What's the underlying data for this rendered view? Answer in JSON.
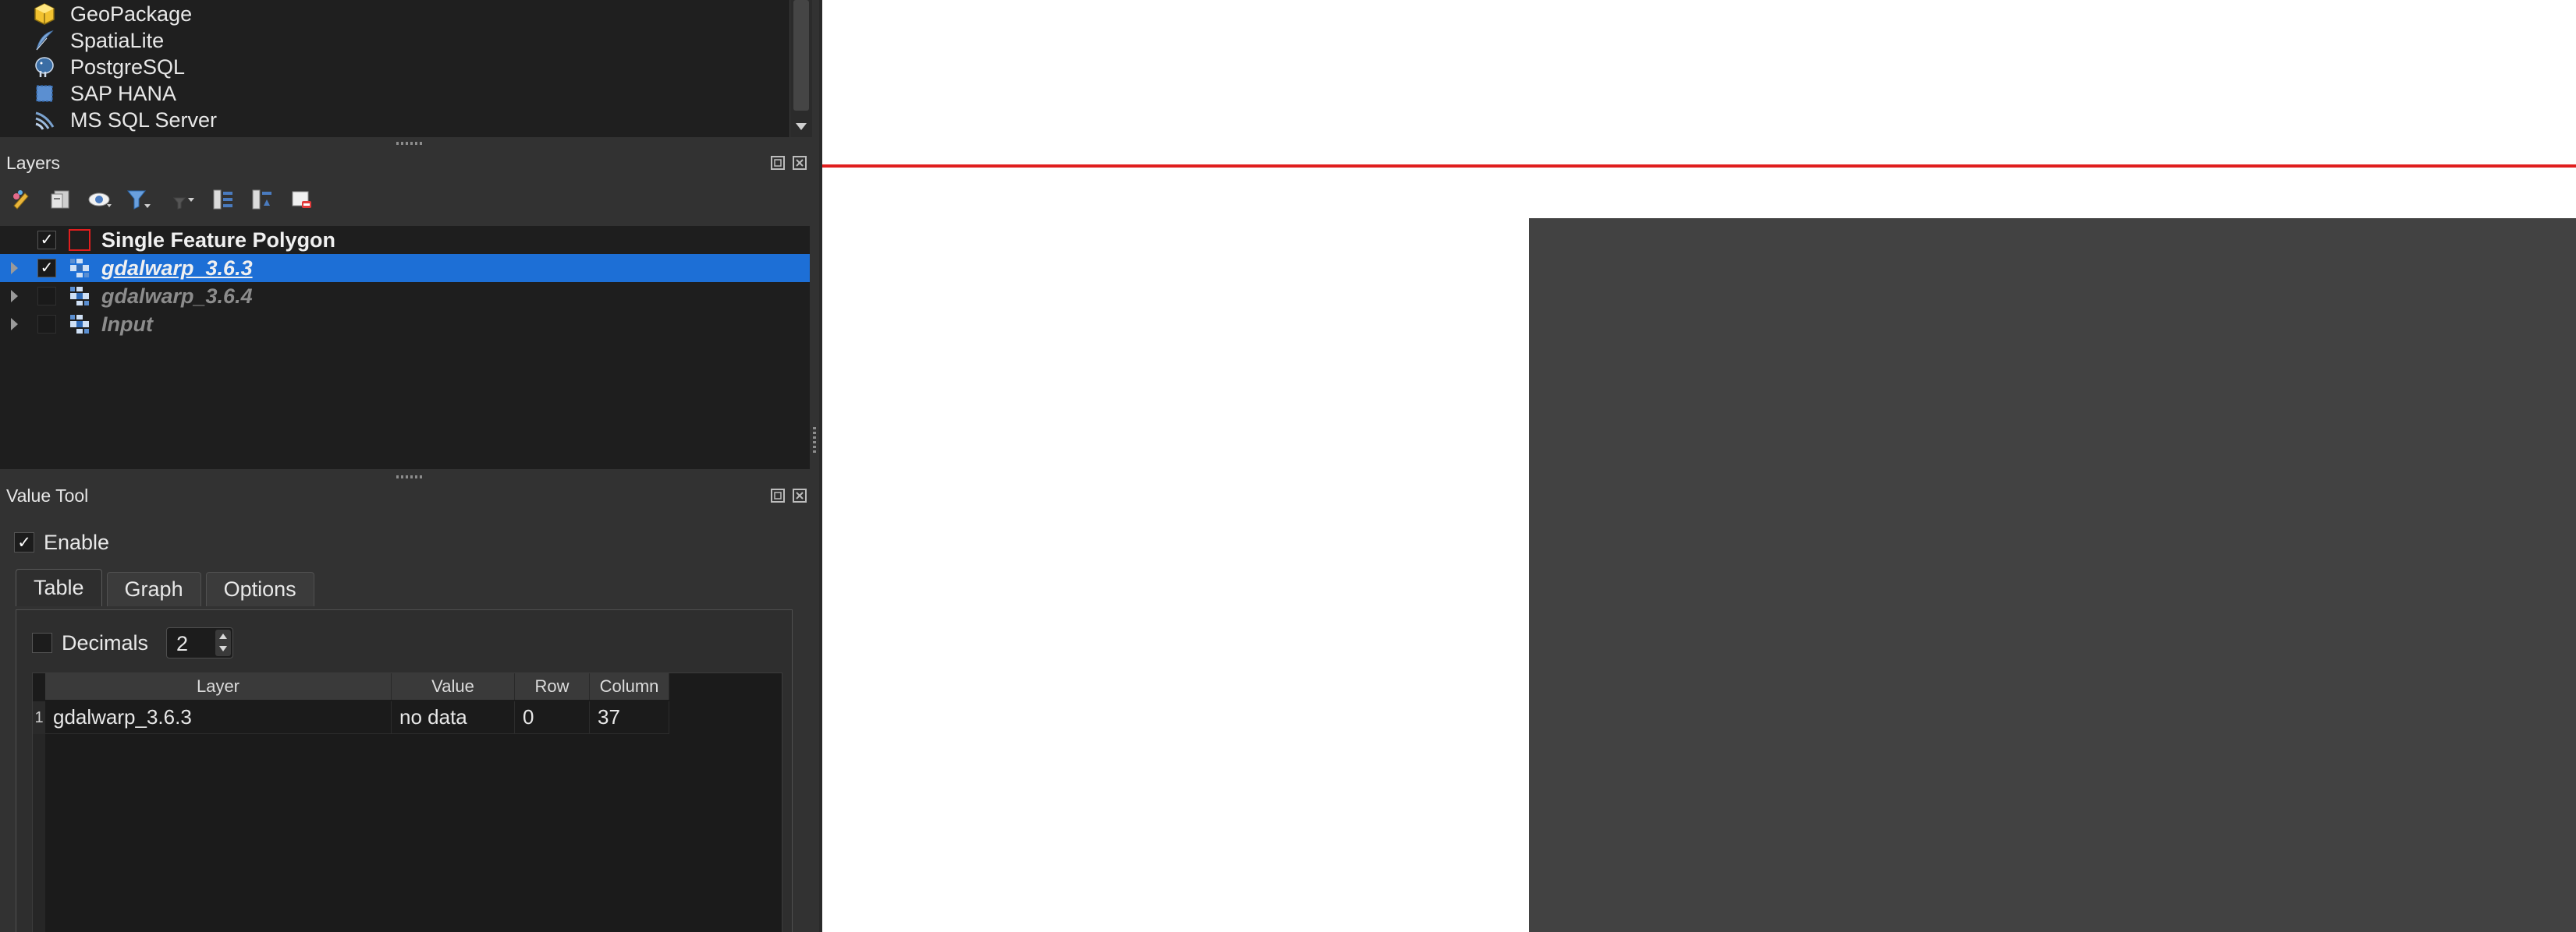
{
  "browser": {
    "items": [
      {
        "label": "GeoPackage",
        "icon": "geopackage-icon"
      },
      {
        "label": "SpatiaLite",
        "icon": "spatialite-feather-icon"
      },
      {
        "label": "PostgreSQL",
        "icon": "postgresql-elephant-icon"
      },
      {
        "label": "SAP HANA",
        "icon": "sap-hana-icon"
      },
      {
        "label": "MS SQL Server",
        "icon": "mssql-server-icon"
      }
    ]
  },
  "layers_panel": {
    "title": "Layers",
    "toolbar": [
      "open-layer-styling-icon",
      "add-group-icon",
      "manage-map-themes-icon",
      "filter-legend-icon",
      "filter-by-expression-icon",
      "expand-all-icon",
      "collapse-all-icon",
      "remove-layer-icon"
    ],
    "layers": [
      {
        "name": "Single Feature Polygon",
        "checked": true,
        "type": "vector-polygon"
      },
      {
        "name": "gdalwarp_3.6.3",
        "checked": true,
        "type": "raster",
        "selected": true
      },
      {
        "name": "gdalwarp_3.6.4",
        "checked": false,
        "type": "raster"
      },
      {
        "name": "Input",
        "checked": false,
        "type": "raster"
      }
    ]
  },
  "value_tool": {
    "title": "Value Tool",
    "enable_label": "Enable",
    "enable_checked": true,
    "tabs": [
      "Table",
      "Graph",
      "Options"
    ],
    "active_tab": "Table",
    "decimals_label": "Decimals",
    "decimals_checked": false,
    "decimals_value": "2",
    "table": {
      "headers": [
        "Layer",
        "Value",
        "Row",
        "Column"
      ],
      "rows": [
        {
          "index": "1",
          "layer": "gdalwarp_3.6.3",
          "value": "no data",
          "row": "0",
          "column": "37"
        }
      ]
    }
  },
  "colors": {
    "selection": "#1d6fd6",
    "polygon_outline": "#e01e1e",
    "raster_fill": "#424242",
    "dock_background": "#323232"
  }
}
